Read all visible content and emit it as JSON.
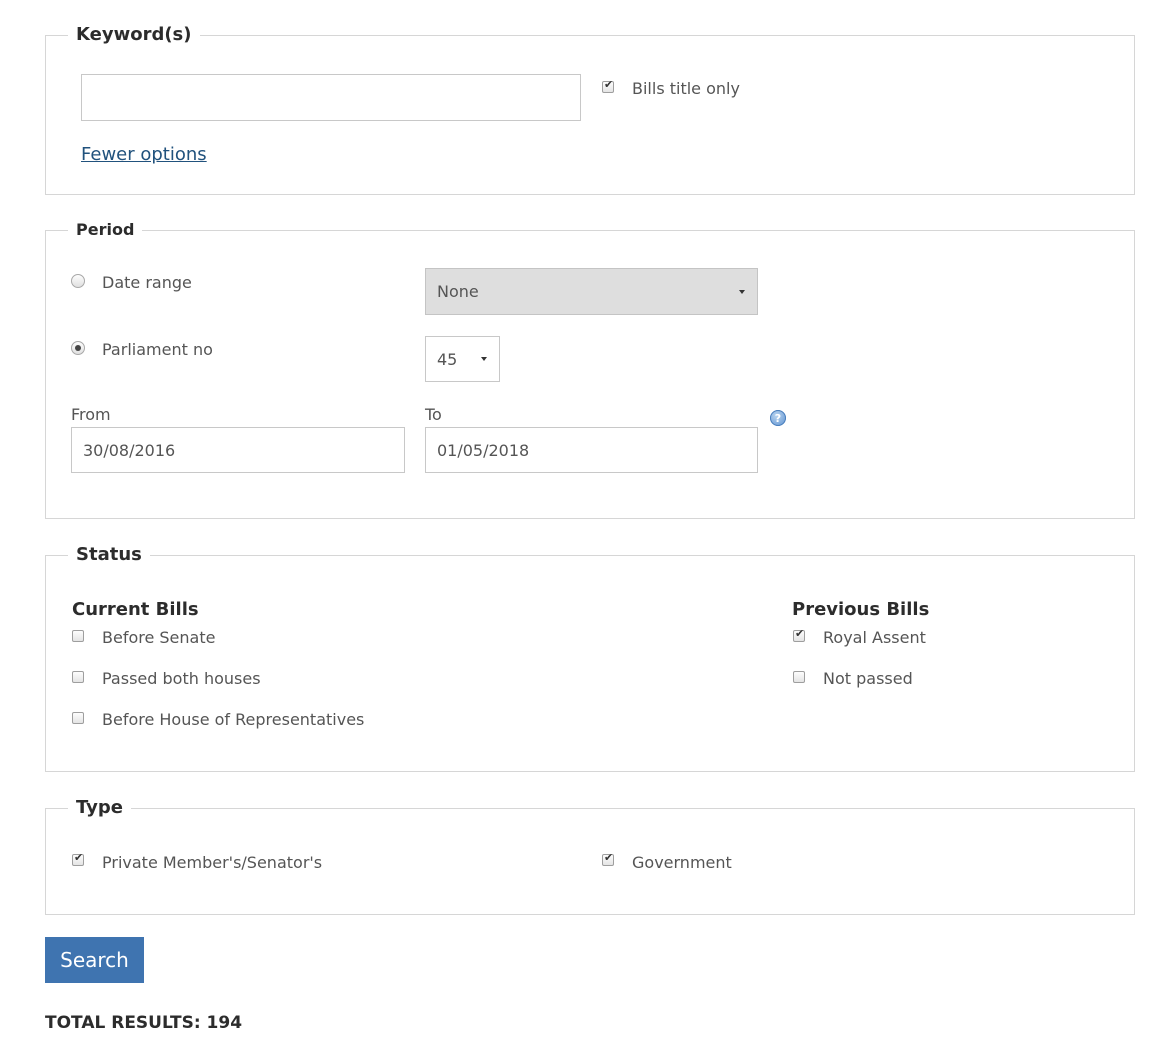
{
  "keywords": {
    "legend": "Keyword(s)",
    "input_value": "",
    "bills_title_only_label": "Bills title only",
    "bills_title_only_checked": true,
    "fewer_options_link": "Fewer options"
  },
  "period": {
    "legend": "Period",
    "date_range_label": "Date range",
    "date_range_selected": "None",
    "parliament_no_label": "Parliament no",
    "parliament_no_selected": "45",
    "from_label": "From",
    "from_value": "30/08/2016",
    "to_label": "To",
    "to_value": "01/05/2018",
    "selected_mode": "parliament_no"
  },
  "status": {
    "legend": "Status",
    "current_heading": "Current Bills",
    "current": [
      {
        "label": "Before Senate",
        "checked": false
      },
      {
        "label": "Passed both houses",
        "checked": false
      },
      {
        "label": "Before House of Representatives",
        "checked": false
      }
    ],
    "previous_heading": "Previous Bills",
    "previous": [
      {
        "label": "Royal Assent",
        "checked": true
      },
      {
        "label": "Not passed",
        "checked": false
      }
    ]
  },
  "type": {
    "legend": "Type",
    "private_label": "Private Member's/Senator's",
    "private_checked": true,
    "government_label": "Government",
    "government_checked": true
  },
  "search_button": "Search",
  "total_results": "TOTAL RESULTS: 194",
  "colors": {
    "button_bg": "#3f74b0",
    "link": "#21527d",
    "border": "#d6d6d6"
  }
}
